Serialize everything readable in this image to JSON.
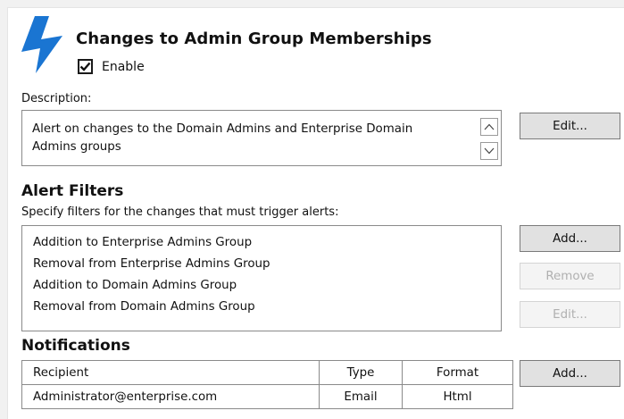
{
  "header": {
    "title": "Changes to Admin Group Memberships",
    "enable_label": "Enable",
    "enable_checked": true,
    "accent_color": "#1a75d2",
    "icon": "lightning-bolt-icon"
  },
  "description": {
    "label": "Description:",
    "text": "Alert on changes to the Domain Admins and Enterprise Domain Admins groups",
    "edit_button": "Edit..."
  },
  "alert_filters": {
    "heading": "Alert Filters",
    "subtitle": "Specify filters for the changes that must trigger alerts:",
    "items": [
      "Addition to Enterprise Admins Group",
      "Removal from Enterprise Admins Group",
      "Addition to Domain Admins Group",
      "Removal from Domain Admins Group"
    ],
    "add_button": "Add...",
    "remove_button": "Remove",
    "edit_button": "Edit..."
  },
  "notifications": {
    "heading": "Notifications",
    "columns": [
      "Recipient",
      "Type",
      "Format"
    ],
    "rows": [
      [
        "Administrator@enterprise.com",
        "Email",
        "Html"
      ]
    ],
    "add_button": "Add..."
  }
}
